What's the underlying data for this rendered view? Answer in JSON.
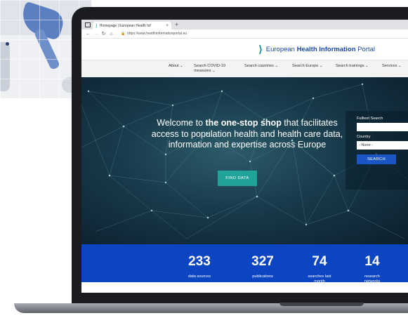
{
  "browser": {
    "tab_title": "Homepage | European Health Inf",
    "tab_close": "×",
    "new_tab": "+",
    "url": "https://www.healthinformationportal.eu"
  },
  "site": {
    "logo_prefix": "European ",
    "logo_bold": "Health Information",
    "logo_suffix": " Portal"
  },
  "nav": [
    {
      "label": "About ⌄"
    },
    {
      "label": "Search COVID-19\nmeasures ⌄"
    },
    {
      "label": "Search countries ⌄"
    },
    {
      "label": "Search Europe ⌄"
    },
    {
      "label": "Search trainings ⌄"
    },
    {
      "label": "Services ⌄"
    }
  ],
  "hero": {
    "welcome_pre": "Welcome to ",
    "welcome_bold": "the one-stop shop",
    "welcome_post": " that facilitates access to population health and health care data, information and expertise across Europe",
    "find_button": "FIND DATA"
  },
  "search": {
    "fulltext_label": "Fulltext Search",
    "fulltext_value": "",
    "country_label": "Country",
    "country_selected": "- None -",
    "button": "SEARCH"
  },
  "stats": [
    {
      "value": "233",
      "label": "data sources"
    },
    {
      "value": "327",
      "label": "publications"
    },
    {
      "value": "74",
      "label": "searches last\nmonth"
    },
    {
      "value": "14",
      "label": "research\nnetworks"
    }
  ],
  "colors": {
    "brand_blue": "#1849a6",
    "brand_teal": "#0c8c8f",
    "stats_band": "#0b45c2",
    "find_button": "#21a39a",
    "search_button": "#1a56c4"
  },
  "icons": [
    "window-icon",
    "favicon-icon",
    "back-icon",
    "forward-icon",
    "reload-icon",
    "home-icon",
    "lock-icon",
    "logo-icon"
  ]
}
